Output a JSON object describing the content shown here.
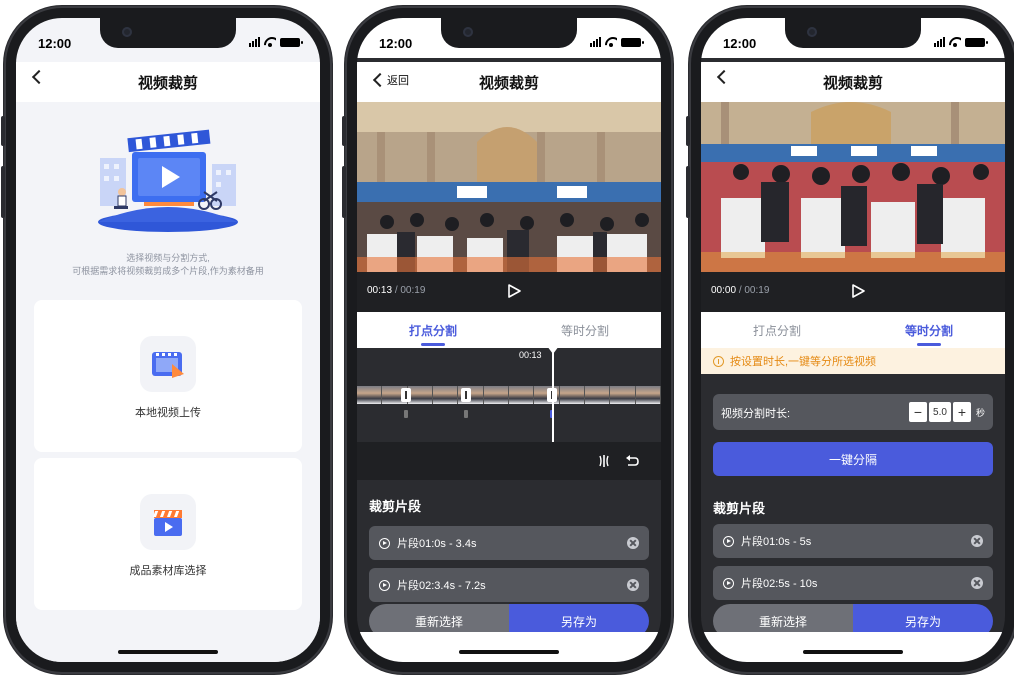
{
  "status_time": "12:00",
  "screen1": {
    "title": "视频裁剪",
    "intro_line1": "选择视频与分割方式,",
    "intro_line2": "可根据需求将视频裁剪成多个片段,作为素材备用",
    "card1_label": "本地视频上传",
    "card2_label": "成品素材库选择"
  },
  "screen2": {
    "back_label": "返回",
    "title": "视频裁剪",
    "current_time": "00:13",
    "total_time": "00:19",
    "tab1": "打点分割",
    "tab2": "等时分割",
    "playhead_time": "00:13",
    "section_title": "裁剪片段",
    "segments": [
      "片段01:0s - 3.4s",
      "片段02:3.4s - 7.2s"
    ],
    "reselect_label": "重新选择",
    "saveas_label": "另存为"
  },
  "screen3": {
    "title": "视频裁剪",
    "current_time": "00:00",
    "total_time": "00:19",
    "tab1": "打点分割",
    "tab2": "等时分割",
    "notice": "按设置时长,一键等分所选视频",
    "duration_label": "视频分割时长:",
    "duration_value": "5.0",
    "duration_unit": "秒",
    "minus": "−",
    "plus": "+",
    "split_button": "一键分隔",
    "section_title": "裁剪片段",
    "segments": [
      "片段01:0s - 5s",
      "片段02:5s - 10s"
    ],
    "reselect_label": "重新选择",
    "saveas_label": "另存为"
  },
  "colors": {
    "accent": "#4a5bdc",
    "dark_bg": "#2b2c30",
    "segment_bg": "#55575d",
    "notice_text": "#e58a14"
  }
}
